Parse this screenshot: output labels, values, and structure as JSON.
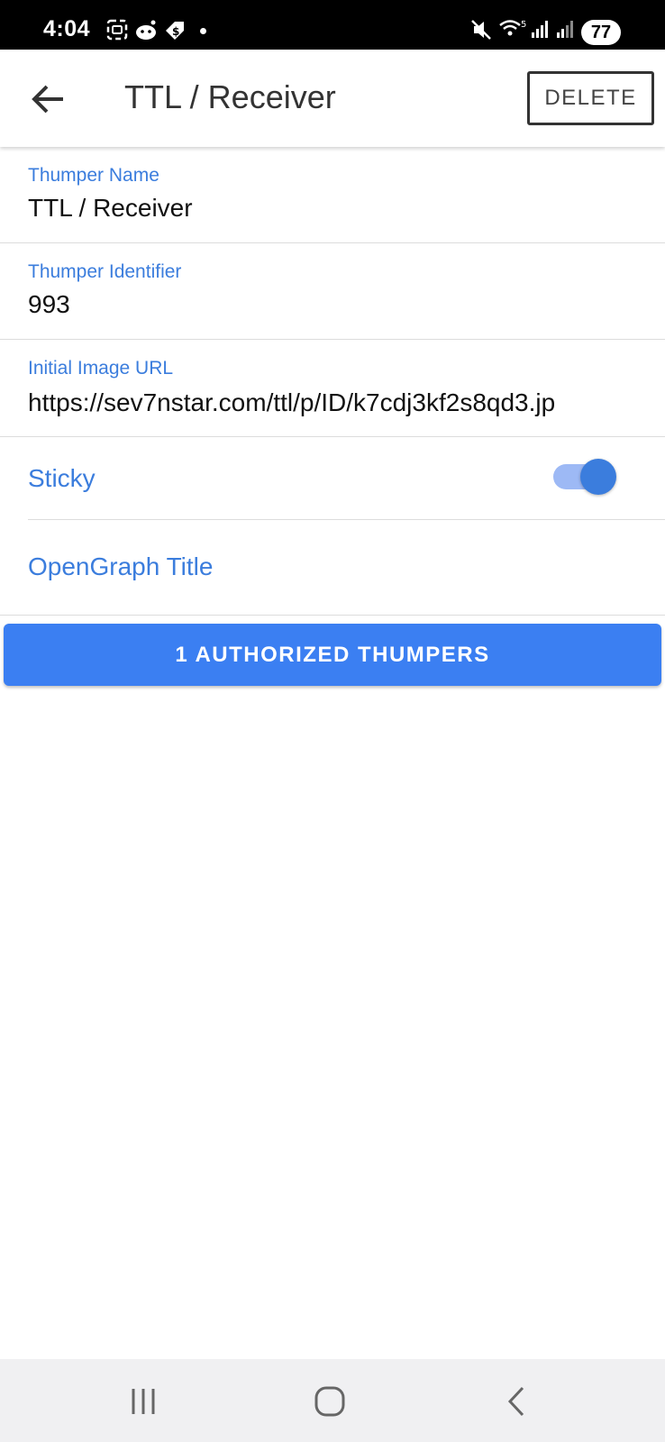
{
  "status_bar": {
    "time": "4:04",
    "battery": "77",
    "icons": [
      "screenshot-icon",
      "reddit-icon",
      "tag-icon",
      "notification-dot-icon",
      "mute-icon",
      "wifi-icon",
      "signal-icon",
      "signal-icon-2"
    ]
  },
  "app_bar": {
    "title": "TTL / Receiver",
    "delete_label": "DELETE",
    "back_icon": "arrow-left-icon"
  },
  "form": {
    "name": {
      "label": "Thumper Name",
      "value": "TTL / Receiver"
    },
    "identifier": {
      "label": "Thumper Identifier",
      "value": "993"
    },
    "image_url": {
      "label": "Initial Image URL",
      "value": "https://sev7nstar.com/ttl/p/ID/k7cdj3kf2s8qd3.jp"
    },
    "sticky": {
      "label": "Sticky",
      "on": true
    },
    "og_title": {
      "label": "OpenGraph Title"
    }
  },
  "authorized_button": {
    "label": "1 AUTHORIZED THUMPERS"
  },
  "nav_bar": {
    "icons": [
      "recents-icon",
      "home-icon",
      "back-icon"
    ]
  },
  "colors": {
    "accent": "#3b7ddd",
    "button": "#3b7ff2",
    "toggle_track": "#9db9f5"
  }
}
